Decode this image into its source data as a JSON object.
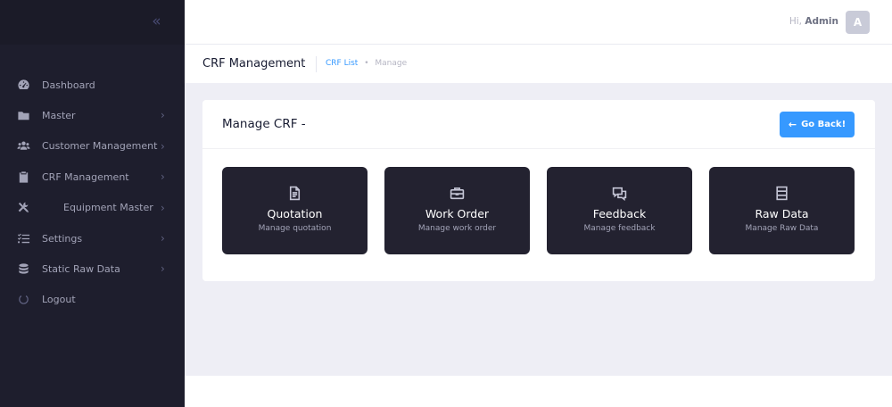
{
  "sidebar": {
    "collapse_glyph": "«",
    "items": [
      {
        "label": "Dashboard",
        "icon": "dashboard-gauge-icon",
        "has_submenu": false
      },
      {
        "label": "Master",
        "icon": "folder-icon",
        "has_submenu": true
      },
      {
        "label": "Customer Management",
        "icon": "users-icon",
        "has_submenu": true
      },
      {
        "label": "CRF Management",
        "icon": "clipboard-icon",
        "has_submenu": true
      },
      {
        "label": "Equipment Master",
        "icon": "tools-icon",
        "has_submenu": true
      },
      {
        "label": "Settings",
        "icon": "list-check-icon",
        "has_submenu": true
      },
      {
        "label": "Static Raw Data",
        "icon": "database-icon",
        "has_submenu": true
      },
      {
        "label": "Logout",
        "icon": "power-icon",
        "has_submenu": false
      }
    ],
    "arrow_glyph": "›"
  },
  "header": {
    "greeting": "Hi,",
    "user_name": "Admin",
    "avatar_letter": "A"
  },
  "subheader": {
    "title": "CRF Management",
    "breadcrumb": [
      "CRF List",
      "Manage"
    ],
    "separator": "•"
  },
  "card": {
    "title": "Manage CRF -",
    "back_button": {
      "label": "Go Back!",
      "arrow": "←"
    },
    "tiles": [
      {
        "title": "Quotation",
        "subtitle": "Manage quotation",
        "icon": "document-icon"
      },
      {
        "title": "Work Order",
        "subtitle": "Manage work order",
        "icon": "briefcase-icon"
      },
      {
        "title": "Feedback",
        "subtitle": "Manage feedback",
        "icon": "chat-bubbles-icon"
      },
      {
        "title": "Raw Data",
        "subtitle": "Manage Raw Data",
        "icon": "table-rows-icon"
      }
    ]
  },
  "colors": {
    "sidebar_bg": "#1e1e2d",
    "primary": "#3699ff",
    "tile_bg": "#232230",
    "content_bg": "#eeeef5"
  }
}
